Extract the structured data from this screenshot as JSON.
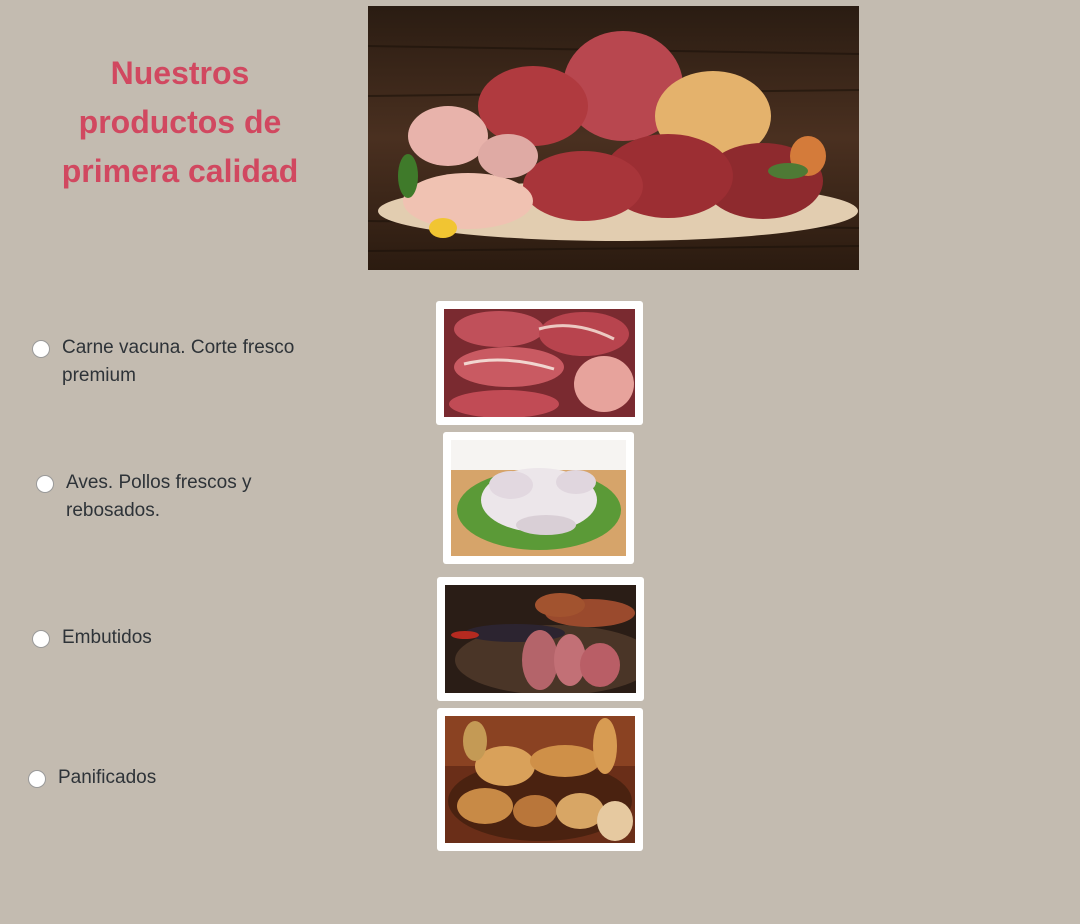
{
  "header": {
    "title": "Nuestros productos de primera calidad",
    "hero_image": "assorted-meats-photo"
  },
  "options": [
    {
      "label": "Carne vacuna. Corte fresco premium",
      "image": "beef-cuts-photo",
      "selected": false
    },
    {
      "label": "Aves. Pollos frescos y rebosados.",
      "image": "raw-chicken-photo",
      "selected": false
    },
    {
      "label": "Embutidos",
      "image": "sausages-photo",
      "selected": false
    },
    {
      "label": "Panificados",
      "image": "bread-photo",
      "selected": false
    }
  ],
  "colors": {
    "background": "#c3bbb0",
    "title": "#d14860",
    "text": "#2e3338"
  }
}
